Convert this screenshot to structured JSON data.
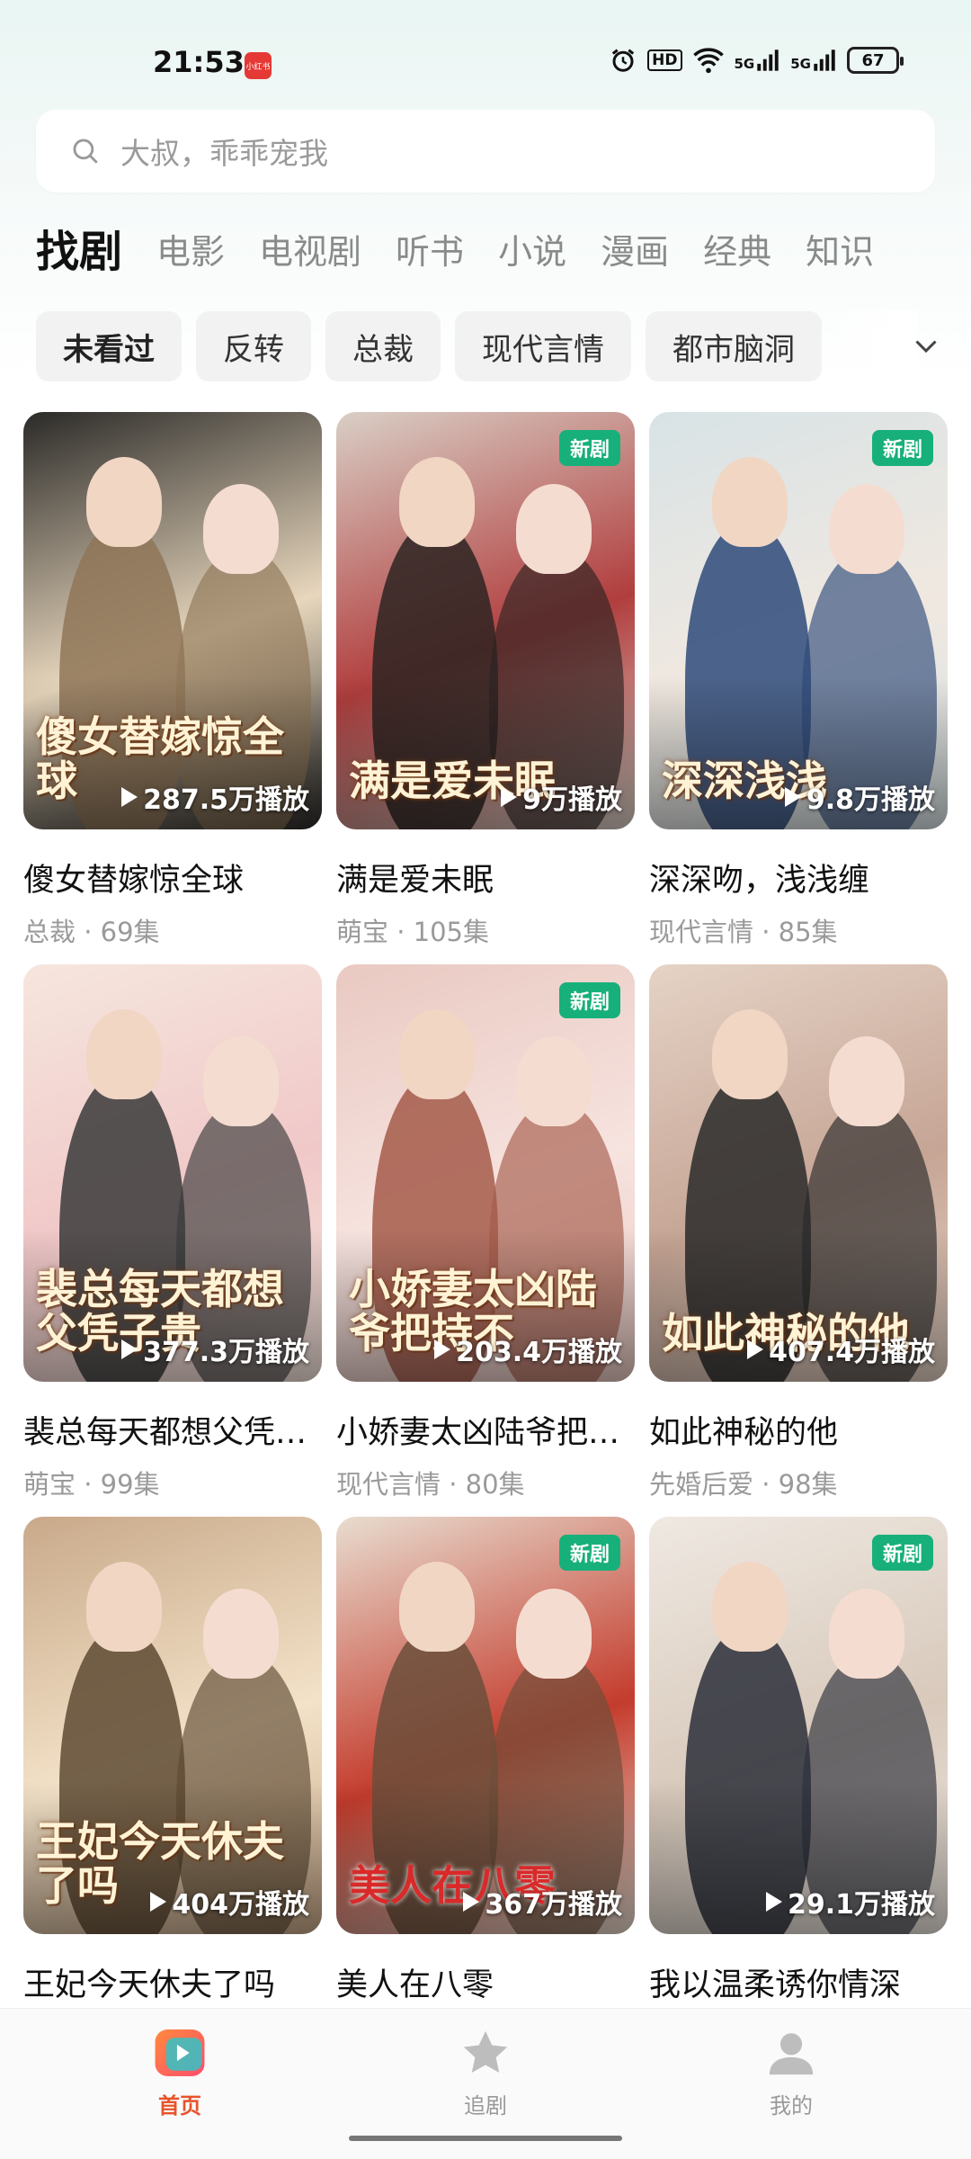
{
  "status_bar": {
    "time": "21:53",
    "app_badge": "小红书",
    "network": "5G",
    "hd": "HD",
    "battery": "67"
  },
  "search": {
    "placeholder": "大叔，乖乖宠我"
  },
  "category_tabs": [
    "找剧",
    "电影",
    "电视剧",
    "听书",
    "小说",
    "漫画",
    "经典",
    "知识"
  ],
  "filter_chips": [
    "未看过",
    "反转",
    "总裁",
    "现代言情",
    "都市脑洞"
  ],
  "cards": [
    {
      "title": "傻女替嫁惊全球",
      "meta": "总裁 · 69集",
      "plays": "287.5万播放",
      "poster_text": "傻女替嫁惊全球",
      "new": false,
      "badge": ""
    },
    {
      "title": "满是爱未眠",
      "meta": "萌宝 · 105集",
      "plays": "9万播放",
      "poster_text": "满是爱未眠",
      "new": true,
      "badge": "新剧"
    },
    {
      "title": "深深吻，浅浅缠",
      "meta": "现代言情 · 85集",
      "plays": "9.8万播放",
      "poster_text": "深深浅浅",
      "new": true,
      "badge": "新剧"
    },
    {
      "title": "裴总每天都想父凭子贵",
      "meta": "萌宝 · 99集",
      "plays": "377.3万播放",
      "poster_text": "裴总每天都想父凭子贵",
      "new": false,
      "badge": ""
    },
    {
      "title": "小娇妻太凶陆爷把持不住",
      "meta": "现代言情 · 80集",
      "plays": "203.4万播放",
      "poster_text": "小娇妻太凶陆爷把持不",
      "new": true,
      "badge": "新剧"
    },
    {
      "title": "如此神秘的他",
      "meta": "先婚后爱 · 98集",
      "plays": "407.4万播放",
      "poster_text": "如此神秘的他",
      "new": false,
      "badge": ""
    },
    {
      "title": "王妃今天休夫了吗",
      "meta": "",
      "plays": "404万播放",
      "poster_text": "王妃今天休夫了吗",
      "new": false,
      "badge": ""
    },
    {
      "title": "美人在八零",
      "meta": "",
      "plays": "367万播放",
      "poster_text": "美人在八零",
      "new": true,
      "badge": "新剧"
    },
    {
      "title": "我以温柔诱你情深",
      "meta": "",
      "plays": "29.1万播放",
      "poster_text": "",
      "new": true,
      "badge": "新剧"
    }
  ],
  "poster_colors": [
    [
      "#2b2a28",
      "#8f7658",
      "#e8d7bd"
    ],
    [
      "#d9cfc6",
      "#2d2422",
      "#b13e3e"
    ],
    [
      "#d8e3e6",
      "#2e4a7a",
      "#f0e8e0"
    ],
    [
      "#f6e6de",
      "#3a3a3a",
      "#f0c8c8"
    ],
    [
      "#e9c9c2",
      "#a55a4a",
      "#f7e3df"
    ],
    [
      "#e5d3c6",
      "#2a2a2a",
      "#c6a595"
    ],
    [
      "#c9a98a",
      "#5e4a33",
      "#f3e2c8"
    ],
    [
      "#e8ddd0",
      "#6b4f3b",
      "#c43c2d"
    ],
    [
      "#efe9e2",
      "#2c2f3a",
      "#d8c9bb"
    ]
  ],
  "bottom_nav": [
    {
      "label": "首页",
      "icon": "home-play-icon",
      "active": true
    },
    {
      "label": "追剧",
      "icon": "star-icon",
      "active": false
    },
    {
      "label": "我的",
      "icon": "user-icon",
      "active": false
    }
  ],
  "accent_color": "#e8532a",
  "new_badge_color": "#18b07a"
}
